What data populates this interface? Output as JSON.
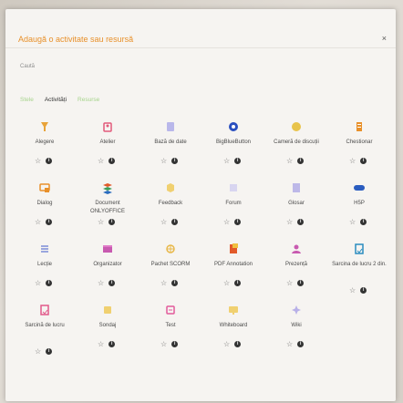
{
  "modal": {
    "title": "Adaugă o activitate sau resursă",
    "close_glyph": "×",
    "search_placeholder": "Caută"
  },
  "tabs": [
    {
      "label": "Stele",
      "active": false
    },
    {
      "label": "Activități",
      "active": true
    },
    {
      "label": "Resurse",
      "active": false
    }
  ],
  "activities": [
    {
      "label": "Alegere",
      "icon": "choice-icon",
      "color": "#e8a33a"
    },
    {
      "label": "Atelier",
      "icon": "workshop-icon",
      "color": "#e25a7a"
    },
    {
      "label": "Bază de date",
      "icon": "database-icon",
      "color": "#b9b7ea"
    },
    {
      "label": "BigBlueButton",
      "icon": "bigbluebutton-icon",
      "color": "#2a4fbf"
    },
    {
      "label": "Cameră de discuții",
      "icon": "chat-icon",
      "color": "#e8c34a"
    },
    {
      "label": "Chestionar",
      "icon": "feedback-questionnaire-icon",
      "color": "#e8902a"
    },
    {
      "label": "Dialog",
      "icon": "dialogue-icon",
      "color": "#e8902a"
    },
    {
      "label": "Document ONLYOFFICE",
      "icon": "onlyoffice-icon",
      "color": "#3c8c4a"
    },
    {
      "label": "Feedback",
      "icon": "feedback-icon",
      "color": "#f0d070"
    },
    {
      "label": "Forum",
      "icon": "forum-icon",
      "color": "#d8d5f0"
    },
    {
      "label": "Glosar",
      "icon": "glossary-icon",
      "color": "#bdb8e8"
    },
    {
      "label": "H5P",
      "icon": "h5p-icon",
      "color": "#2a5cbf"
    },
    {
      "label": "Lecție",
      "icon": "lesson-icon",
      "color": "#7b8bd8"
    },
    {
      "label": "Organizator",
      "icon": "organizer-icon",
      "color": "#c85ab0"
    },
    {
      "label": "Pachet SCORM",
      "icon": "scorm-icon",
      "color": "#e8b84a"
    },
    {
      "label": "PDF Annotation",
      "icon": "pdf-annotation-icon",
      "color": "#e25a2a"
    },
    {
      "label": "Prezență",
      "icon": "attendance-icon",
      "color": "#c85ab0"
    },
    {
      "label": "Sarcina de lucru 2 din.",
      "icon": "assignment2-icon",
      "color": "#2a8cbf"
    },
    {
      "label": "Sarcină de lucru",
      "icon": "assignment-icon",
      "color": "#e25a8a"
    },
    {
      "label": "Sondaj",
      "icon": "survey-icon",
      "color": "#f0d070"
    },
    {
      "label": "Test",
      "icon": "quiz-icon",
      "color": "#e25a9a"
    },
    {
      "label": "Whiteboard",
      "icon": "whiteboard-icon",
      "color": "#f0d070"
    },
    {
      "label": "Wiki",
      "icon": "wiki-icon",
      "color": "#b8b0e8"
    }
  ],
  "tile_actions": {
    "star_glyph": "☆",
    "info_glyph": "i"
  }
}
